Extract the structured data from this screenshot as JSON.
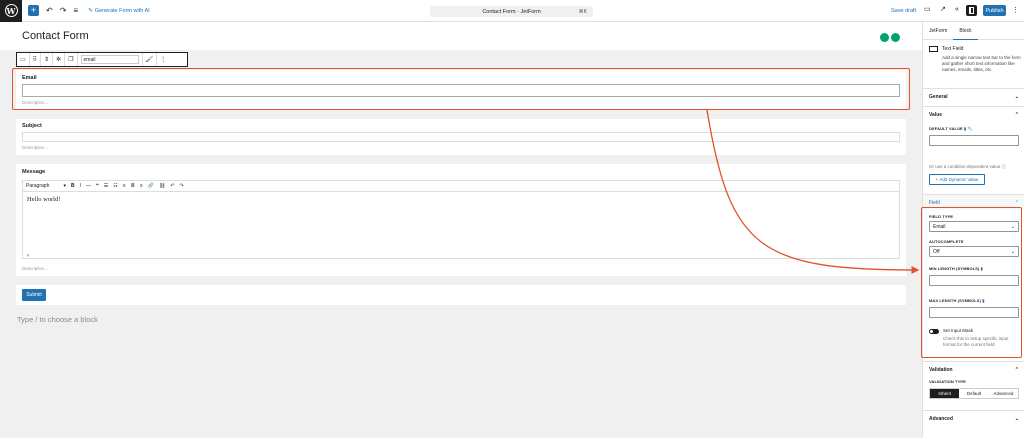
{
  "topbar": {
    "wp_logo": "W",
    "add_block_icon": "plus-icon",
    "undo_icon": "undo-icon",
    "redo_icon": "redo-icon",
    "doc_overview_icon": "list-view-icon",
    "generate_label": "Generate Form with AI",
    "document_title": "Contact Form · JetForm",
    "shortcut": "⌘K",
    "save_draft": "Save draft",
    "publish": "Publish"
  },
  "editor": {
    "page_title": "Contact Form",
    "toolbar": {
      "field_name": "email"
    },
    "fields": [
      {
        "label": "Email",
        "description": "Description..."
      },
      {
        "label": "Subject",
        "description": "Description..."
      },
      {
        "label": "Message",
        "description": "Description..."
      }
    ],
    "rte": {
      "paragraph": "Paragraph",
      "content": "Hello world!",
      "status": "p"
    },
    "submit_label": "Submit",
    "type_hint": "Type / to choose a block"
  },
  "sidebar": {
    "tabs": [
      "JetForm",
      "Block"
    ],
    "block_title": "Text Field",
    "block_desc": "Add a single narrow text bar to the form and gather short text information like names, emails, titles, etc.",
    "general": "General",
    "value": "Value",
    "default_value_label": "DEFAULT VALUE",
    "condition_hint": "Or use a condition-dependent value",
    "add_dynamic": "Add Dynamic Value",
    "field": "Field",
    "field_type_label": "FIELD TYPE",
    "field_type_value": "Email",
    "autocomplete_label": "AUTOCOMPLETE",
    "autocomplete_value": "Off",
    "min_length_label": "MIN LENGTH (SYMBOLS)",
    "max_length_label": "MAX LENGTH (SYMBOLS)",
    "input_mask_label": "Set Input Mask",
    "input_mask_hint": "Check this to setup specific input format for the current field",
    "validation": "Validation",
    "validation_type_label": "VALIDATION TYPE",
    "validation_options": [
      "Inherit",
      "Default",
      "Advanced"
    ],
    "advanced": "Advanced"
  },
  "colors": {
    "accent": "#2271b1",
    "highlight": "#e0522c",
    "jet_green": "#00a36f"
  }
}
